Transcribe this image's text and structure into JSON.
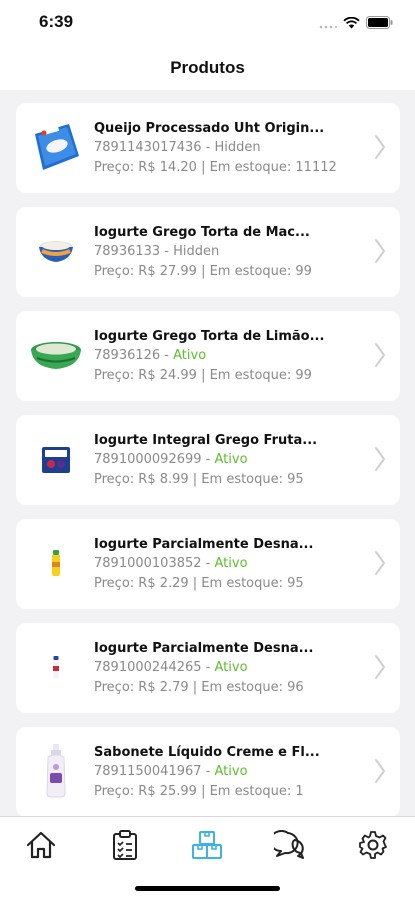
{
  "status_bar": {
    "time": "6:39"
  },
  "header": {
    "title": "Produtos"
  },
  "products": [
    {
      "name": "Queijo Processado Uht Origin...",
      "code": "7891143017436",
      "status": "Hidden",
      "status_type": "hidden",
      "price_stock": "Preço: R$ 14.20 | Em estoque: 11112",
      "image": "cheese-box-image"
    },
    {
      "name": "Iogurte Grego Torta de Mac...",
      "code": "78936133",
      "status": "Hidden",
      "status_type": "hidden",
      "price_stock": "Preço: R$ 27.99 | Em estoque: 99",
      "image": "yogurt-tub-image"
    },
    {
      "name": "Iogurte Grego Torta de Limão...",
      "code": "78936126",
      "status": "Ativo",
      "status_type": "ativo",
      "price_stock": "Preço: R$ 24.99 | Em estoque: 99",
      "image": "yogurt-tub-image"
    },
    {
      "name": "Iogurte Integral Grego Fruta...",
      "code": "7891000092699",
      "status": "Ativo",
      "status_type": "ativo",
      "price_stock": "Preço: R$ 8.99 | Em estoque: 95",
      "image": "yogurt-pack-image"
    },
    {
      "name": "Iogurte Parcialmente Desna...",
      "code": "7891000103852",
      "status": "Ativo",
      "status_type": "ativo",
      "price_stock": "Preço: R$ 2.29 | Em estoque: 95",
      "image": "yogurt-bottle-image"
    },
    {
      "name": "Iogurte Parcialmente Desna...",
      "code": "7891000244265",
      "status": "Ativo",
      "status_type": "ativo",
      "price_stock": "Preço: R$ 2.79 | Em estoque: 96",
      "image": "yogurt-bottle-image"
    },
    {
      "name": "Sabonete Líquido Creme e Fl...",
      "code": "7891150041967",
      "status": "Ativo",
      "status_type": "ativo",
      "price_stock": "Preço: R$ 25.99 | Em estoque: 1",
      "image": "soap-bottle-image"
    }
  ],
  "separator": " - ",
  "tabs": [
    {
      "icon": "home-icon",
      "active": false
    },
    {
      "icon": "clipboard-list-icon",
      "active": false
    },
    {
      "icon": "boxes-icon",
      "active": true
    },
    {
      "icon": "chat-bubbles-icon",
      "active": false
    },
    {
      "icon": "gear-icon",
      "active": false
    }
  ],
  "colors": {
    "active_status": "#5cbf2c",
    "active_tab": "#3bb3e6",
    "muted": "#8a8a8a"
  }
}
